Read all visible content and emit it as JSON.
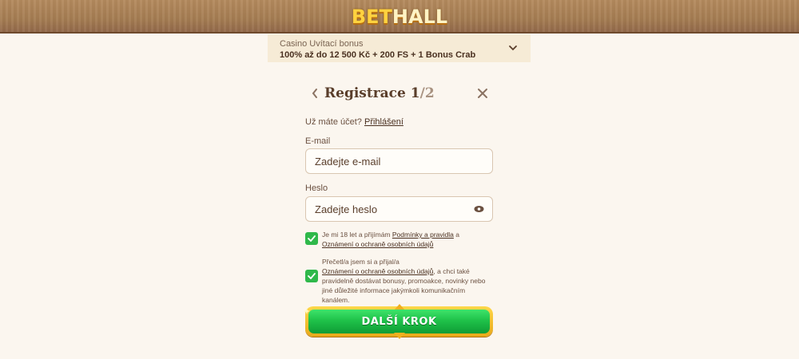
{
  "header": {
    "logo_part1": "BET",
    "logo_part2": "HALL"
  },
  "bonus": {
    "title": "Casino Uvítací bonus",
    "text": "100% až do 12 500 Kč + 200 FS + 1 Bonus Crab"
  },
  "form": {
    "title": "Registrace 1",
    "step_suffix": "/2",
    "have_account": "Už máte účet?",
    "login_link": "Přihlášení",
    "email_label": "E-mail",
    "email_placeholder": "Zadejte e-mail",
    "password_label": "Heslo",
    "password_placeholder": "Zadejte heslo",
    "consent1_pre": "Je mi 18 let a přijímám ",
    "consent1_link1": "Podmínky a pravidla",
    "consent1_mid": " a ",
    "consent1_link2": "Oznámení o ochraně osobních údajů",
    "consent2_pre": "Přečetl/a jsem si a přijal/a ",
    "consent2_link": "Oznámení o ochraně osobních údajů",
    "consent2_post": ", a chci také pravidelně dostávat bonusy, promoakce, novinky nebo jiné důležité informace jakýmkoli komunikačním kanálem.",
    "next_label": "DALŠÍ KROK"
  },
  "colors": {
    "accent_green": "#2fb84a",
    "gold": "#f0b020",
    "text_brown": "#5a3e2b"
  }
}
